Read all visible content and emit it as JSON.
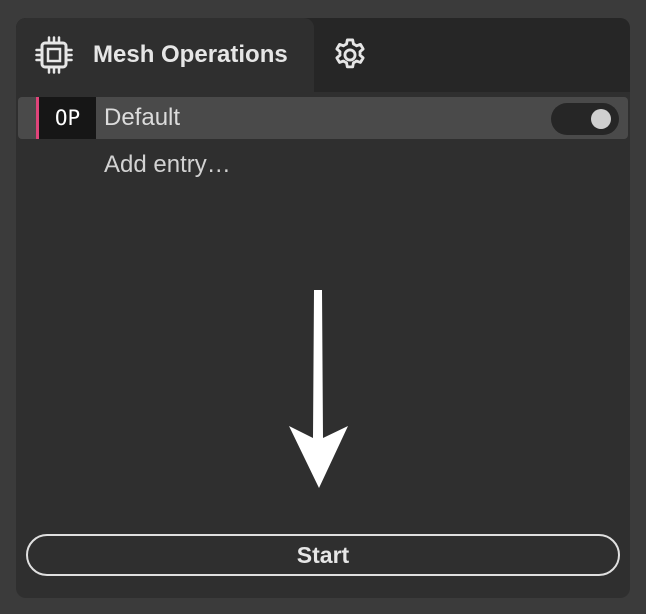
{
  "tabs": {
    "active": {
      "title": "Mesh Operations",
      "icon": "chip-icon"
    },
    "settings": {
      "icon": "gear-icon"
    }
  },
  "entries": [
    {
      "badge": "OP",
      "label": "Default",
      "enabled": true
    }
  ],
  "add_entry_label": "Add entry…",
  "start_label": "Start",
  "colors": {
    "accent": "#e0447a",
    "panel": "#2f2f2f",
    "background": "#3b3b3b"
  }
}
